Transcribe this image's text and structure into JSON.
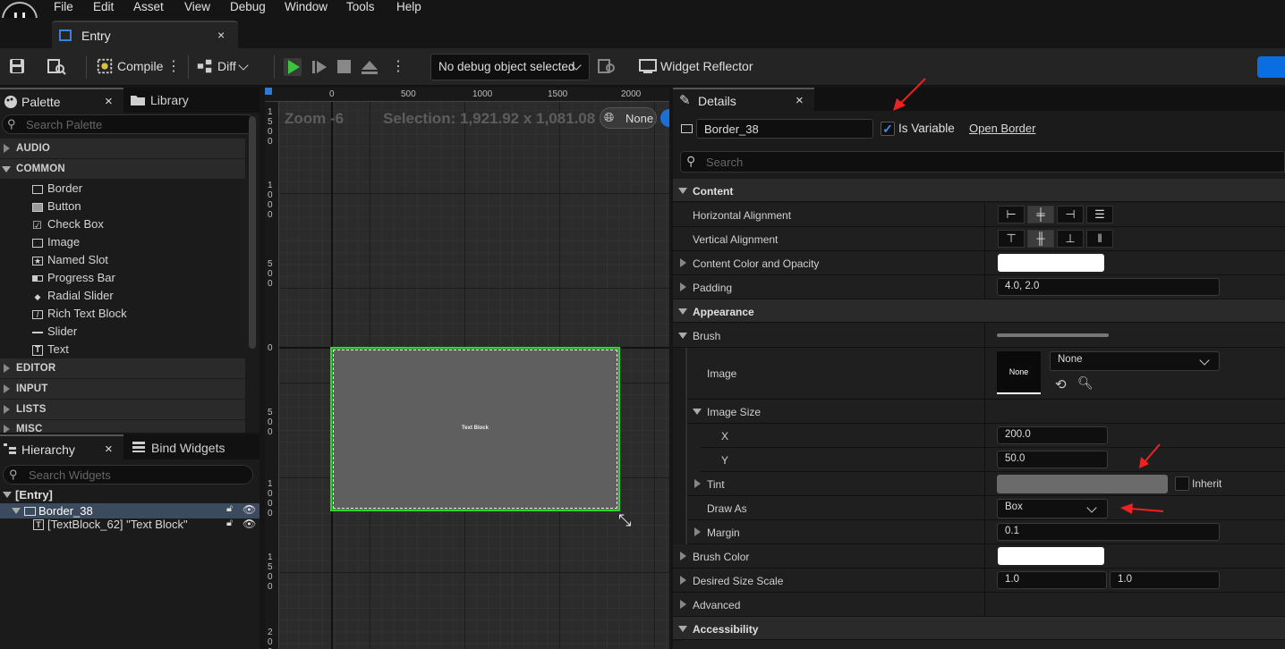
{
  "app": {
    "logo_text": "U"
  },
  "menu": [
    "File",
    "Edit",
    "Asset",
    "View",
    "Debug",
    "Window",
    "Tools",
    "Help"
  ],
  "document_tab": {
    "label": "Entry",
    "close": "×"
  },
  "toolbar": {
    "compile_label": "Compile",
    "diff_label": "Diff",
    "debug_select": "No debug object selected",
    "widget_reflector_label": "Widget Reflector"
  },
  "palette": {
    "tab_palette": "Palette",
    "tab_library": "Library",
    "close": "×",
    "search_placeholder": "Search Palette",
    "categories_top": [
      "AUDIO",
      "COMMON"
    ],
    "common_items": [
      {
        "label": "Border",
        "icon": "border-icon"
      },
      {
        "label": "Button",
        "icon": "button-icon"
      },
      {
        "label": "Check Box",
        "icon": "checkbox-icon"
      },
      {
        "label": "Image",
        "icon": "image-icon"
      },
      {
        "label": "Named Slot",
        "icon": "named-slot-icon"
      },
      {
        "label": "Progress Bar",
        "icon": "progress-bar-icon"
      },
      {
        "label": "Radial Slider",
        "icon": "radial-slider-icon"
      },
      {
        "label": "Rich Text Block",
        "icon": "rich-text-icon"
      },
      {
        "label": "Slider",
        "icon": "slider-icon"
      },
      {
        "label": "Text",
        "icon": "text-icon"
      }
    ],
    "categories_bottom": [
      "EDITOR",
      "INPUT",
      "LISTS",
      "MISC"
    ]
  },
  "hierarchy": {
    "tab_hierarchy": "Hierarchy",
    "tab_bind": "Bind Widgets",
    "close": "×",
    "search_placeholder": "Search Widgets",
    "root": "[Entry]",
    "selected": "Border_38",
    "child": "[TextBlock_62] \"Text Block\""
  },
  "canvas": {
    "zoom": "Zoom -6",
    "selection": "Selection: 1,921.92 x 1,081.08",
    "none_label": "None",
    "ruler_top": [
      "0",
      "500",
      "1000",
      "1500",
      "2000"
    ],
    "ruler_left": [
      "1500",
      "1000",
      "500",
      "0",
      "500",
      "1000",
      "1500",
      "2000"
    ],
    "widget_text": "Text Block"
  },
  "details": {
    "tab_label": "Details",
    "close": "×",
    "name_value": "Border_38",
    "is_variable_label": "Is Variable",
    "is_variable": true,
    "open_border": "Open Border",
    "search_placeholder": "Search",
    "sections": {
      "content": "Content",
      "appearance": "Appearance",
      "accessibility": "Accessibility"
    },
    "labels": {
      "h_align": "Horizontal Alignment",
      "v_align": "Vertical Alignment",
      "content_color": "Content Color and Opacity",
      "padding": "Padding",
      "brush": "Brush",
      "image": "Image",
      "image_size": "Image Size",
      "x": "X",
      "y": "Y",
      "tint": "Tint",
      "draw_as": "Draw As",
      "margin": "Margin",
      "brush_color": "Brush Color",
      "desired_size_scale": "Desired Size Scale",
      "advanced": "Advanced",
      "inherit": "Inherit"
    },
    "values": {
      "padding": "4.0, 2.0",
      "image_thumb": "None",
      "image_select": "None",
      "x": "200.0",
      "y": "50.0",
      "draw_as": "Box",
      "margin": "0.1",
      "scale_x": "1.0",
      "scale_y": "1.0"
    },
    "colors": {
      "tint": "#6b6b6b",
      "content_color": "#ffffff",
      "brush_color": "#ffffff",
      "accent": "#2d7ad6",
      "selection_green": "#22dd22",
      "annotation_red": "#ee2222"
    }
  }
}
